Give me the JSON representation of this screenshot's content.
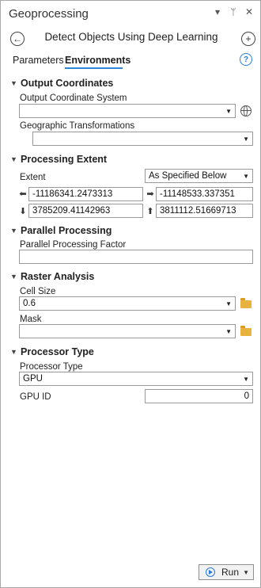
{
  "pane": {
    "title": "Geoprocessing",
    "icons": [
      "▾",
      "📌",
      "✕"
    ]
  },
  "tool": {
    "title": "Detect Objects Using Deep Learning"
  },
  "tabs": [
    "Parameters",
    "Environments"
  ],
  "help": "?",
  "sections": {
    "output_coordinates": {
      "title": "Output Coordinates",
      "ocs_label": "Output Coordinate System",
      "ocs_value": "",
      "gt_label": "Geographic Transformations",
      "gt_value": ""
    },
    "processing_extent": {
      "title": "Processing Extent",
      "extent_label": "Extent",
      "extent_value": "As Specified Below",
      "left": "-11186341.2473313",
      "right": "-11148533.337351",
      "bottom": "3785209.41142963",
      "top": "3811112.51669713"
    },
    "parallel_processing": {
      "title": "Parallel Processing",
      "ppf_label": "Parallel Processing Factor",
      "ppf_value": ""
    },
    "raster_analysis": {
      "title": "Raster Analysis",
      "cell_size_label": "Cell Size",
      "cell_size_value": "0.6",
      "mask_label": "Mask",
      "mask_value": ""
    },
    "processor_type": {
      "title": "Processor Type",
      "pt_label": "Processor Type",
      "pt_value": "GPU",
      "gpu_id_label": "GPU ID",
      "gpu_id_value": "0"
    }
  },
  "run_button": {
    "label": "Run"
  },
  "colors": {
    "accent": "#2b88d8",
    "folder": "#e8b23e",
    "border": "#9a9a9a"
  }
}
